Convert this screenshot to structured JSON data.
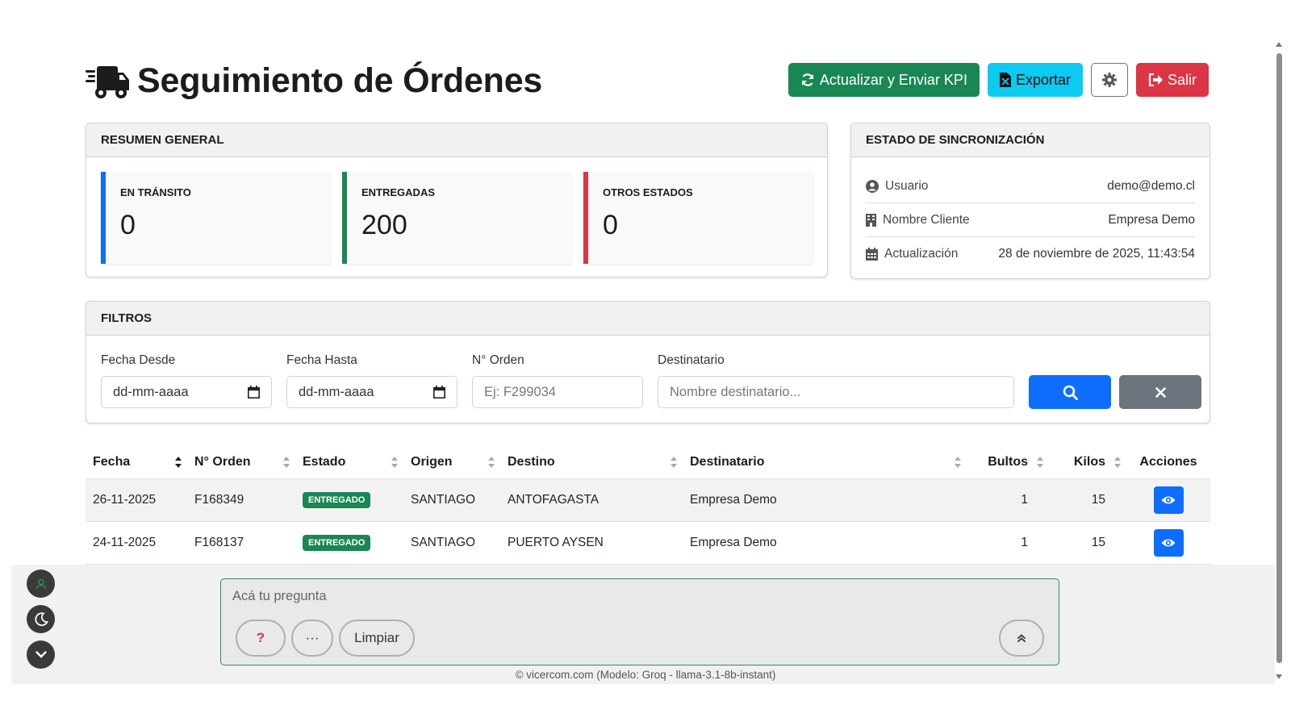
{
  "header": {
    "title": "Seguimiento de Órdenes",
    "buttons": {
      "kpi": "Actualizar y Enviar KPI",
      "export": "Exportar",
      "logout": "Salir"
    }
  },
  "summary": {
    "title": "RESUMEN GENERAL",
    "stats": [
      {
        "label": "EN TRÁNSITO",
        "value": "0",
        "color": "#0d6efd"
      },
      {
        "label": "ENTREGADAS",
        "value": "200",
        "color": "#198754"
      },
      {
        "label": "OTROS ESTADOS",
        "value": "0",
        "color": "#dc3545"
      }
    ]
  },
  "sync": {
    "title": "ESTADO DE SINCRONIZACIÓN",
    "rows": [
      {
        "label": "Usuario",
        "value": "demo@demo.cl",
        "icon": "user-circle-icon"
      },
      {
        "label": "Nombre Cliente",
        "value": "Empresa Demo",
        "icon": "building-icon"
      },
      {
        "label": "Actualización",
        "value": "28 de noviembre de 2025, 11:43:54",
        "icon": "calendar-icon"
      }
    ]
  },
  "filters": {
    "title": "FILTROS",
    "fecha_desde": {
      "label": "Fecha Desde",
      "value": "dd-mm-aaaa"
    },
    "fecha_hasta": {
      "label": "Fecha Hasta",
      "value": "dd-mm-aaaa"
    },
    "orden": {
      "label": "N° Orden",
      "placeholder": "Ej: F299034"
    },
    "destinatario": {
      "label": "Destinatario",
      "placeholder": "Nombre destinatario..."
    }
  },
  "table": {
    "headers": [
      "Fecha",
      "N° Orden",
      "Estado",
      "Origen",
      "Destino",
      "Destinatario",
      "Bultos",
      "Kilos",
      "Acciones"
    ],
    "rows": [
      {
        "fecha": "26-11-2025",
        "orden": "F168349",
        "estado": "ENTREGADO",
        "origen": "SANTIAGO",
        "destino": "ANTOFAGASTA",
        "destinatario": "Empresa Demo",
        "bultos": "1",
        "kilos": "15"
      },
      {
        "fecha": "24-11-2025",
        "orden": "F168137",
        "estado": "ENTREGADO",
        "origen": "SANTIAGO",
        "destino": "PUERTO AYSEN",
        "destinatario": "Empresa Demo",
        "bultos": "1",
        "kilos": "15"
      }
    ]
  },
  "chat": {
    "placeholder": "Acá tu pregunta",
    "help": "?",
    "more": "···",
    "clear": "Limpiar",
    "footer": "© vicercom.com (Modelo: Groq - llama-3.1-8b-instant)"
  }
}
